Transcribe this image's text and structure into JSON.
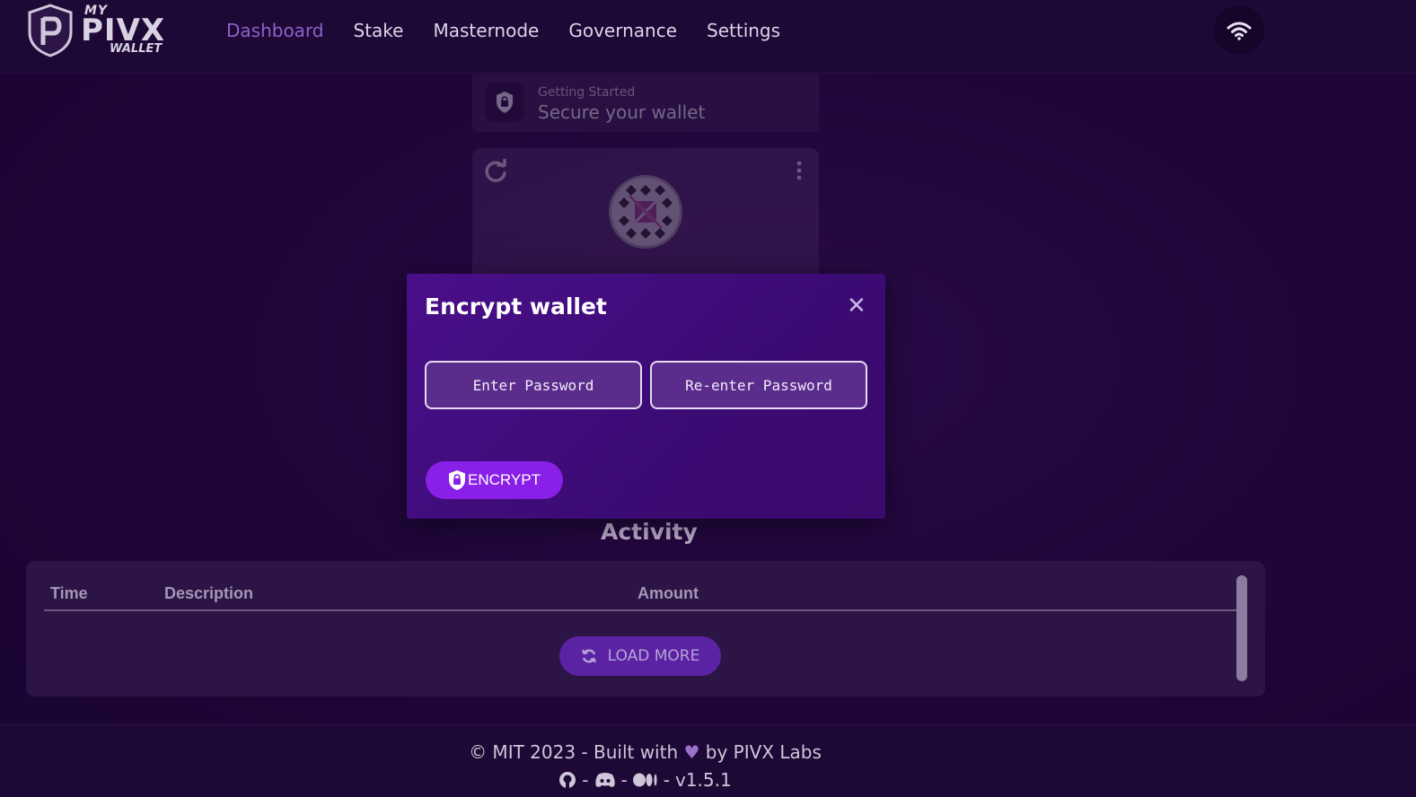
{
  "brand": {
    "my": "MY",
    "name": "PIVX",
    "sub": "WALLET"
  },
  "nav": {
    "items": [
      {
        "label": "Dashboard",
        "active": true
      },
      {
        "label": "Stake"
      },
      {
        "label": "Masternode"
      },
      {
        "label": "Governance"
      },
      {
        "label": "Settings"
      }
    ]
  },
  "getting_started": {
    "small": "Getting Started",
    "big": "Secure your wallet"
  },
  "modal": {
    "title": "Encrypt wallet",
    "close": "✕",
    "password_placeholder": "Enter Password",
    "confirm_placeholder": "Re-enter Password",
    "encrypt_label": "ENCRYPT"
  },
  "activity": {
    "title": "Activity",
    "columns": {
      "time": "Time",
      "description": "Description",
      "amount": "Amount"
    },
    "load_more": "LOAD MORE"
  },
  "footer": {
    "line1_pre": "© MIT 2023 - Built with",
    "line1_post": "by PIVX Labs",
    "sep": "-",
    "version": "v1.5.1"
  },
  "colors": {
    "accent": "#8a1fe8",
    "nav_active": "#8a64c8",
    "modal_bg": "#4a0f8a",
    "background": "#260a45"
  },
  "icons": [
    "pivx-shield-icon",
    "wifi-icon",
    "lock-icon",
    "refresh-icon",
    "kebab-menu-icon",
    "close-icon",
    "sync-icon",
    "heart-icon",
    "github-icon",
    "discord-icon",
    "medium-icon"
  ]
}
